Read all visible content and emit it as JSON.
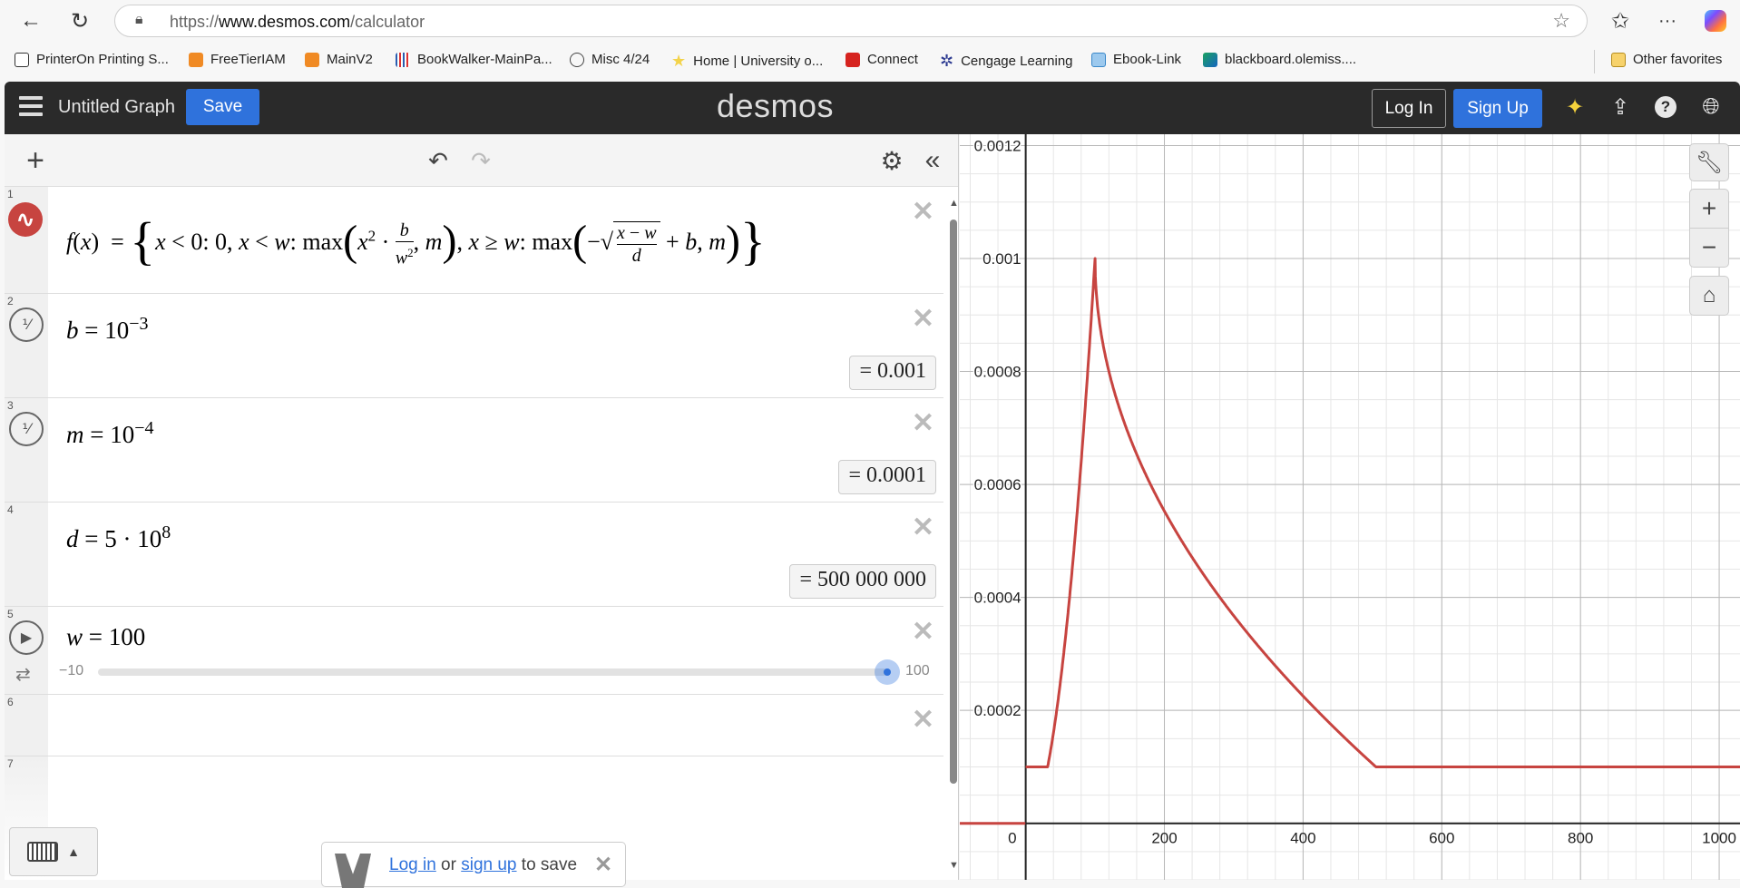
{
  "browser": {
    "url_prefix": "https://",
    "url_domain": "www.desmos.com",
    "url_path": "/calculator",
    "bookmarks": [
      {
        "label": "PrinterOn Printing S...",
        "icon": "page-icon"
      },
      {
        "label": "FreeTierIAM",
        "icon": "cube-icon"
      },
      {
        "label": "MainV2",
        "icon": "cube-icon"
      },
      {
        "label": "BookWalker-MainPa...",
        "icon": "books-icon"
      },
      {
        "label": "Misc 4/24",
        "icon": "openai-icon"
      },
      {
        "label": "Home | University o...",
        "icon": "star-icon"
      },
      {
        "label": "Connect",
        "icon": "mcgraw-icon"
      },
      {
        "label": "Cengage Learning",
        "icon": "cengage-icon"
      },
      {
        "label": "Ebook-Link",
        "icon": "book-icon"
      },
      {
        "label": "blackboard.olemiss....",
        "icon": "blackboard-icon"
      }
    ],
    "other_favorites": "Other favorites"
  },
  "header": {
    "title": "Untitled Graph",
    "save": "Save",
    "logo": "desmos",
    "login": "Log In",
    "signup": "Sign Up"
  },
  "expressions": [
    {
      "index": "1"
    },
    {
      "index": "2",
      "var": "b",
      "base": "10",
      "exp": "−3",
      "result": "= 0.001"
    },
    {
      "index": "3",
      "var": "m",
      "base": "10",
      "exp": "−4",
      "result": "= 0.0001"
    },
    {
      "index": "4",
      "var": "d",
      "coef": "5 · 10",
      "exp": "8",
      "result": "= 500 000 000"
    },
    {
      "index": "5",
      "var": "w",
      "value": "100",
      "slider_min": "−10",
      "slider_max": "100",
      "slider_fraction": 1.0
    },
    {
      "index": "6"
    },
    {
      "index": "7"
    }
  ],
  "toast": {
    "login": "Log in",
    "or": " or ",
    "signup": "sign up",
    "rest": " to save"
  },
  "chart_data": {
    "type": "line",
    "title": "",
    "xlabel": "",
    "ylabel": "",
    "xlim": [
      -95,
      1030
    ],
    "ylim": [
      -0.0001,
      0.00122
    ],
    "x_ticks": [
      0,
      200,
      400,
      600,
      800,
      1000
    ],
    "y_ticks": [
      0.0002,
      0.0004,
      0.0006,
      0.0008,
      0.001,
      0.0012
    ],
    "x_tick_labels": [
      "0",
      "200",
      "400",
      "600",
      "800",
      "1000"
    ],
    "y_tick_labels": [
      "0.0002",
      "0.0004",
      "0.0006",
      "0.0008",
      "0.001",
      "0.0012"
    ],
    "grid": true,
    "series": [
      {
        "name": "f(x)",
        "color": "#c74440",
        "params": {
          "b": 0.001,
          "m": 0.0001,
          "d": 500000000,
          "w": 100
        }
      }
    ]
  }
}
